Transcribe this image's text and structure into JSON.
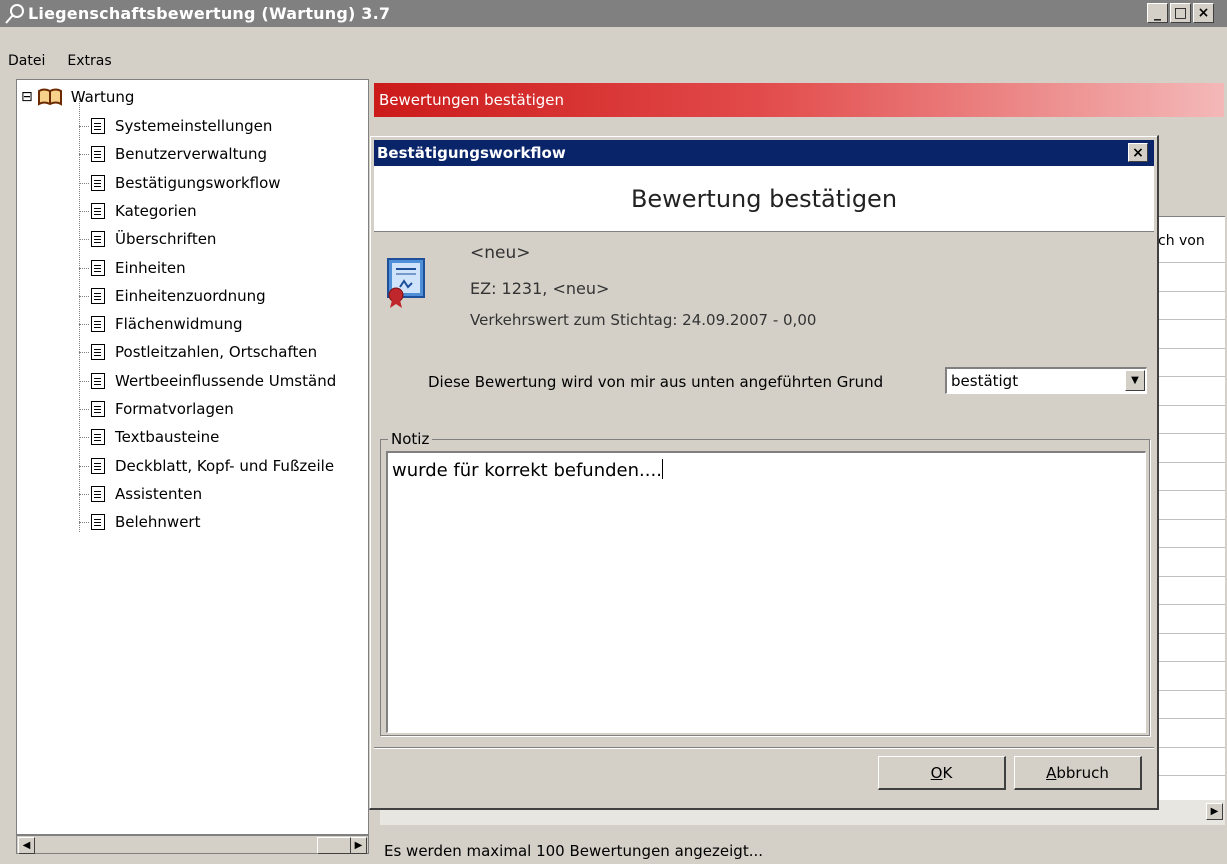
{
  "window": {
    "title": "Liegenschaftsbewertung (Wartung) 3.7",
    "minimize_label": "_",
    "maximize_label": "□",
    "close_label": "×"
  },
  "menu": {
    "items": [
      "Datei",
      "Extras"
    ]
  },
  "tree": {
    "root": "Wartung",
    "root_toggle": "⊟",
    "children": [
      "Systemeinstellungen",
      "Benutzerverwaltung",
      "Bestätigungsworkflow",
      "Kategorien",
      "Überschriften",
      "Einheiten",
      "Einheitenzuordnung",
      "Flächenwidmung",
      "Postleitzahlen, Ortschaften",
      "Wertbeeinflussende Umständ",
      "Formatvorlagen",
      "Textbausteine",
      "Deckblatt, Kopf- und Fußzeile",
      "Assistenten",
      "Belehnwert"
    ]
  },
  "main": {
    "header": "Bewertungen bestätigen",
    "grid_cell": "ch von",
    "status": "Es werden maximal 100 Bewertungen angezeigt..."
  },
  "dialog": {
    "title": "Bestätigungsworkflow",
    "close_label": "×",
    "banner": "Bewertung bestätigen",
    "entity_name": "<neu>",
    "ez_line": "EZ: 1231, <neu>",
    "verkehrswert": "Verkehrswert zum Stichtag: 24.09.2007 - 0,00",
    "reason_label": "Diese Bewertung wird von mir aus unten angeführten Grund",
    "reason_value": "bestätigt",
    "notiz_label": "Notiz",
    "notiz_value": "wurde für korrekt befunden....",
    "ok_label": "OK",
    "ok_accel": "O",
    "ok_rest": "K",
    "cancel_accel": "A",
    "cancel_rest": "bbruch"
  },
  "icons": {
    "app": "magnifier-key-icon",
    "root": "open-book-icon",
    "node": "document-icon",
    "certificate": "certificate-icon"
  }
}
